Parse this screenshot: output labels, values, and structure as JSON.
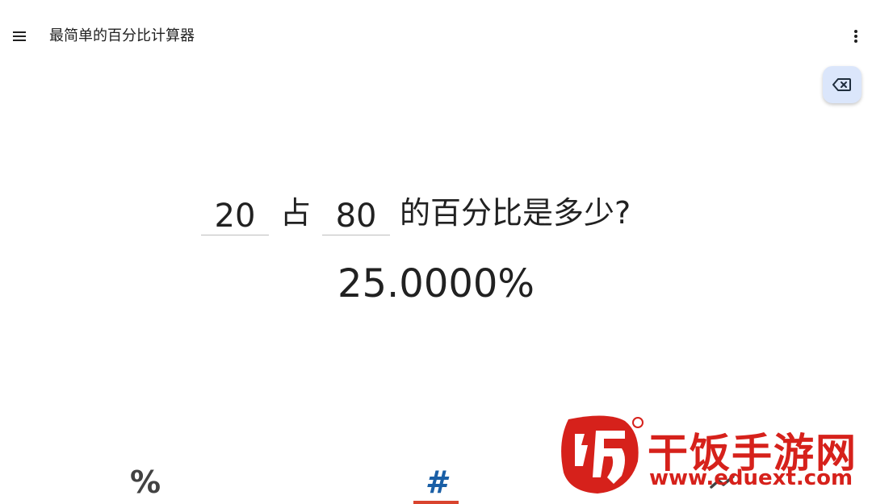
{
  "app_bar": {
    "title": "最简单的百分比计算器",
    "menu_icon": "hamburger-menu-icon",
    "more_icon": "more-vert-icon"
  },
  "backspace": {
    "icon": "backspace-icon",
    "background": "#dbe6fb"
  },
  "question": {
    "value_a": "20",
    "connector": "占",
    "value_b": "80",
    "suffix": "的百分比是多少?"
  },
  "result": {
    "value": "25.0000%"
  },
  "bottom_tabs": [
    {
      "glyph": "%",
      "icon": "percent-icon",
      "active": false
    },
    {
      "glyph": "#",
      "icon": "hash-icon",
      "active": true
    },
    {
      "glyph": "",
      "icon": "trending-icon",
      "active": false
    }
  ],
  "watermark": {
    "text": "干饭手游网",
    "url": "www.eduext.com",
    "color": "#d6211b"
  },
  "colors": {
    "accent": "#1a5fa6",
    "tab_indicator": "#d9442e"
  }
}
